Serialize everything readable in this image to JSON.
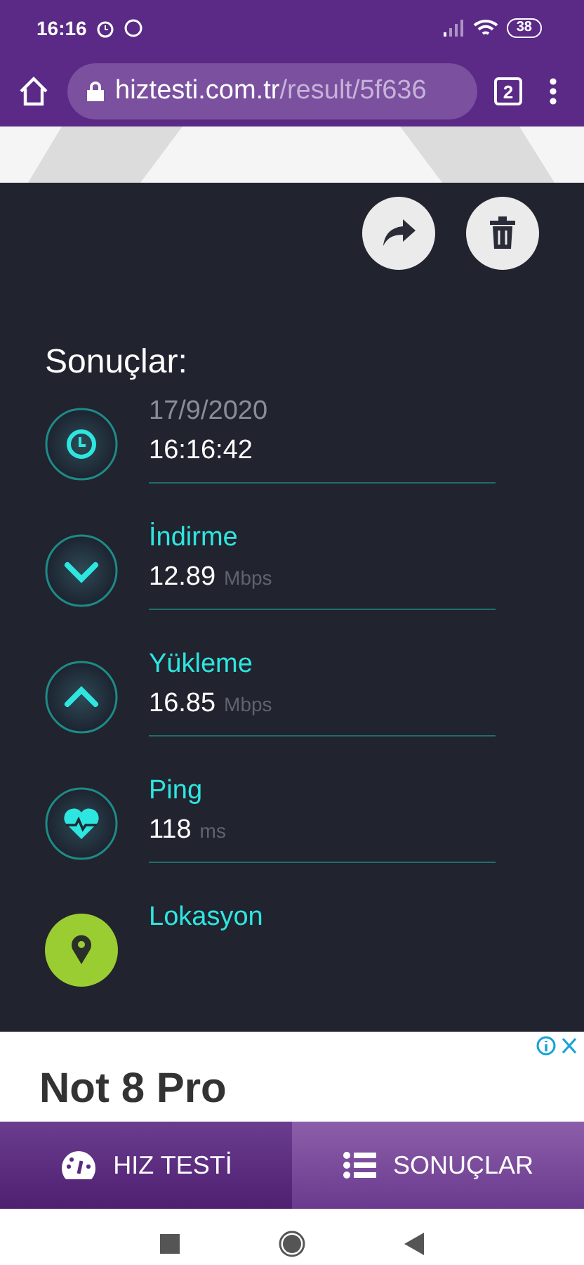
{
  "status_bar": {
    "time": "16:16",
    "battery": "38"
  },
  "browser": {
    "url_host": "hiztesti.com.tr",
    "url_path": "/result/5f636",
    "tab_count": "2"
  },
  "results": {
    "title": "Sonuçlar:",
    "items": [
      {
        "kind": "time",
        "label": "17/9/2020",
        "value": "16:16:42"
      },
      {
        "kind": "download",
        "label": "İndirme",
        "value": "12.89",
        "unit": "Mbps"
      },
      {
        "kind": "upload",
        "label": "Yükleme",
        "value": "16.85",
        "unit": "Mbps"
      },
      {
        "kind": "ping",
        "label": "Ping",
        "value": "118",
        "unit": "ms"
      },
      {
        "kind": "location",
        "label": "Lokasyon"
      }
    ]
  },
  "ad": {
    "headline": "Not 8 Pro"
  },
  "tabs": [
    {
      "label": "HIZ TESTİ",
      "kind": "gauge",
      "selected": false
    },
    {
      "label": "SONUÇLAR",
      "kind": "list",
      "selected": true
    }
  ]
}
